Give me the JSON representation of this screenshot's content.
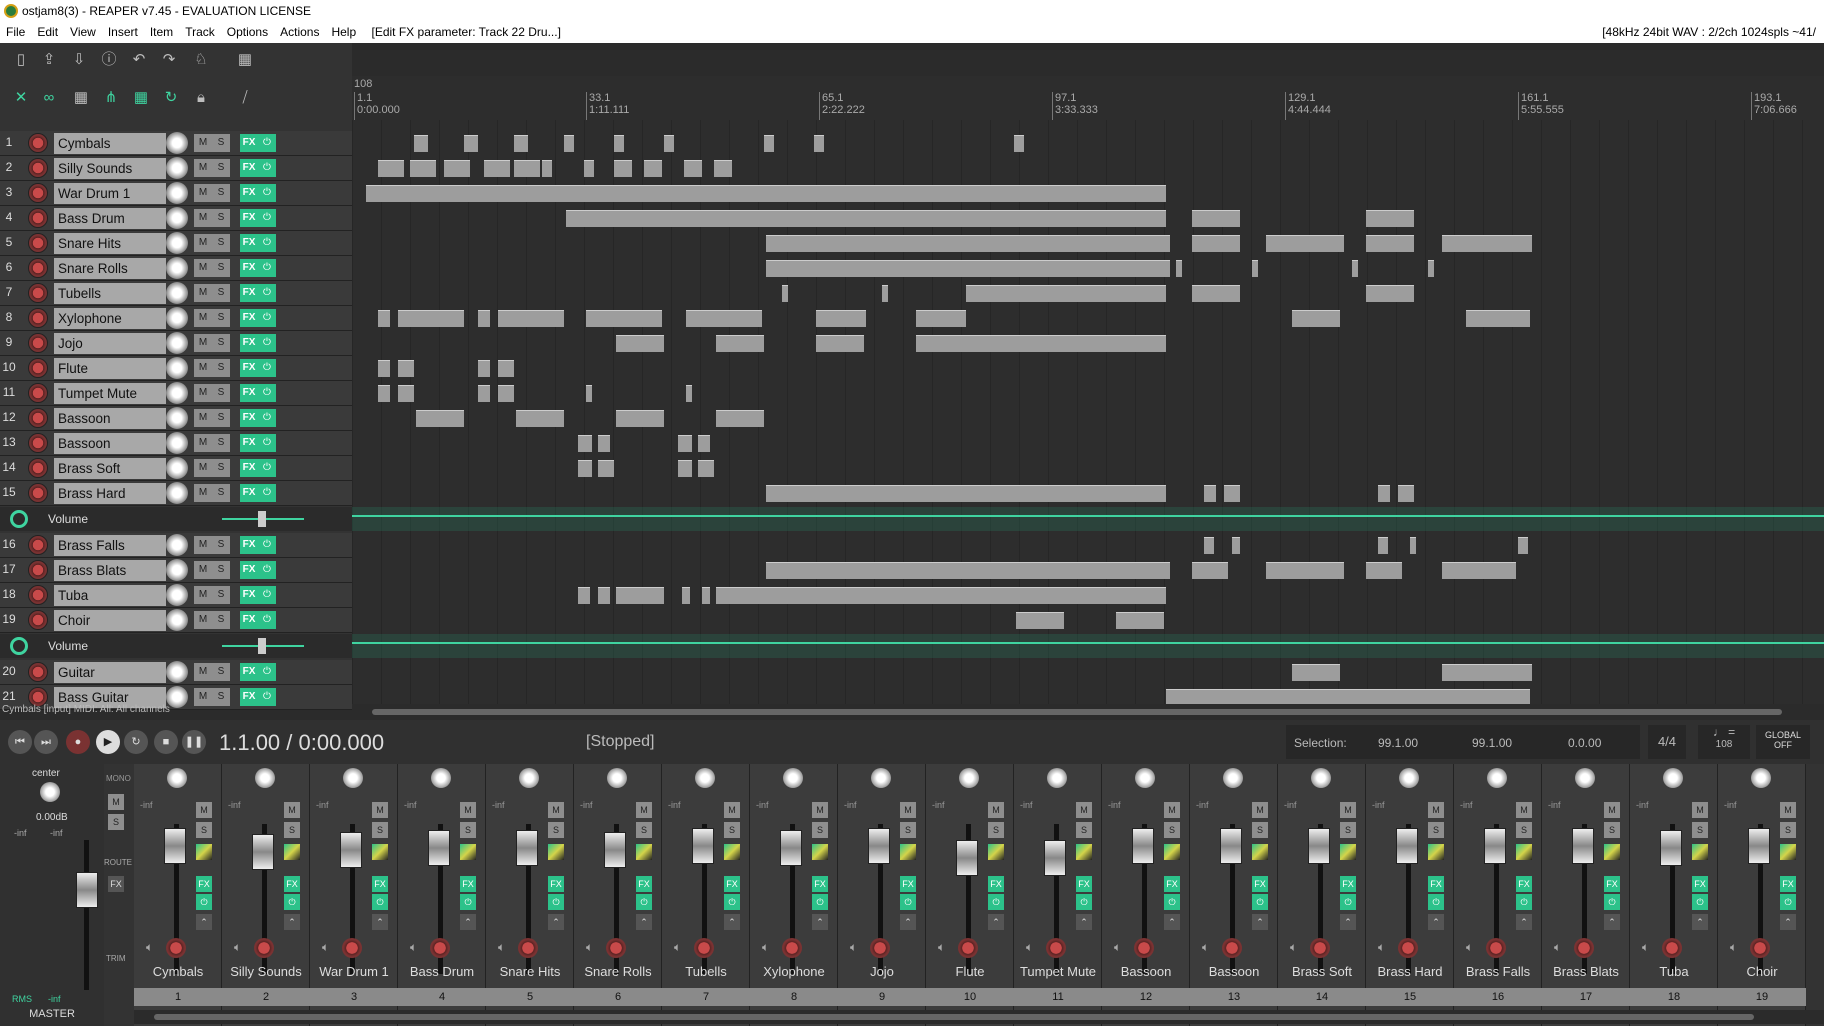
{
  "window": {
    "title": "ostjam8(3) - REAPER v7.45 - EVALUATION LICENSE"
  },
  "menu": {
    "items": [
      "File",
      "Edit",
      "View",
      "Insert",
      "Item",
      "Track",
      "Options",
      "Actions",
      "Help"
    ],
    "hint": "[Edit FX parameter: Track 22 Dru...]",
    "status": "[48kHz 24bit WAV : 2/2ch 1024spls ~41/"
  },
  "ruler": {
    "bpm_marker": "108",
    "ticks": [
      {
        "bar": "1.1",
        "time": "0:00.000"
      },
      {
        "bar": "33.1",
        "time": "1:11.111"
      },
      {
        "bar": "65.1",
        "time": "2:22.222"
      },
      {
        "bar": "97.1",
        "time": "3:33.333"
      },
      {
        "bar": "129.1",
        "time": "4:44.444"
      },
      {
        "bar": "161.1",
        "time": "5:55.555"
      },
      {
        "bar": "193.1",
        "time": "7:06.666"
      }
    ]
  },
  "tracks": [
    {
      "num": "1",
      "name": "Cymbals"
    },
    {
      "num": "2",
      "name": "Silly Sounds"
    },
    {
      "num": "3",
      "name": "War Drum 1"
    },
    {
      "num": "4",
      "name": "Bass Drum"
    },
    {
      "num": "5",
      "name": "Snare Hits"
    },
    {
      "num": "6",
      "name": "Snare Rolls"
    },
    {
      "num": "7",
      "name": "Tubells"
    },
    {
      "num": "8",
      "name": "Xylophone"
    },
    {
      "num": "9",
      "name": "Jojo"
    },
    {
      "num": "10",
      "name": "Flute"
    },
    {
      "num": "11",
      "name": "Tumpet Mute"
    },
    {
      "num": "12",
      "name": "Bassoon"
    },
    {
      "num": "13",
      "name": "Bassoon"
    },
    {
      "num": "14",
      "name": "Brass Soft"
    },
    {
      "num": "15",
      "name": "Brass Hard"
    },
    {
      "num": "16",
      "name": "Brass Falls"
    },
    {
      "num": "17",
      "name": "Brass Blats"
    },
    {
      "num": "18",
      "name": "Tuba"
    },
    {
      "num": "19",
      "name": "Choir"
    },
    {
      "num": "20",
      "name": "Guitar"
    },
    {
      "num": "21",
      "name": "Bass Guitar"
    }
  ],
  "envelope_label": "Volume",
  "track_buttons": {
    "mute": "M",
    "solo": "S",
    "fx": "FX"
  },
  "info_line": "Cymbals [input] MIDI: All: All channels",
  "transport": {
    "time": "1.1.00 / 0:00.000",
    "state": "[Stopped]",
    "selection_label": "Selection:",
    "sel_start": "99.1.00",
    "sel_end": "99.1.00",
    "sel_len": "0.0.00",
    "time_sig": "4/4",
    "tempo": "108",
    "global_label": "GLOBAL",
    "global_state": "OFF"
  },
  "mixer": {
    "master": {
      "pan": "center",
      "vol": "0.00dB",
      "peak_l": "-inf",
      "peak_r": "-inf",
      "name": "MASTER",
      "mode": "RMS",
      "mode_val": "-inf",
      "buttons": [
        "MONO",
        "M",
        "S",
        "ROUTE",
        "FX",
        "TRIM"
      ]
    },
    "fader_readout": "-inf",
    "strips": [
      {
        "name": "Cymbals",
        "num": "1"
      },
      {
        "name": "Silly Sounds",
        "num": "2"
      },
      {
        "name": "War Drum 1",
        "num": "3"
      },
      {
        "name": "Bass Drum",
        "num": "4"
      },
      {
        "name": "Snare Hits",
        "num": "5"
      },
      {
        "name": "Snare Rolls",
        "num": "6"
      },
      {
        "name": "Tubells",
        "num": "7"
      },
      {
        "name": "Xylophone",
        "num": "8"
      },
      {
        "name": "Jojo",
        "num": "9"
      },
      {
        "name": "Flute",
        "num": "10"
      },
      {
        "name": "Tumpet Mute",
        "num": "11"
      },
      {
        "name": "Bassoon",
        "num": "12"
      },
      {
        "name": "Bassoon",
        "num": "13"
      },
      {
        "name": "Brass Soft",
        "num": "14"
      },
      {
        "name": "Brass Hard",
        "num": "15"
      },
      {
        "name": "Brass Falls",
        "num": "16"
      },
      {
        "name": "Brass Blats",
        "num": "17"
      },
      {
        "name": "Tuba",
        "num": "18"
      },
      {
        "name": "Choir",
        "num": "19"
      }
    ]
  },
  "colors": {
    "accent": "#3fd4a0",
    "rec": "#c94a4a",
    "bg": "#2b2b2b"
  }
}
